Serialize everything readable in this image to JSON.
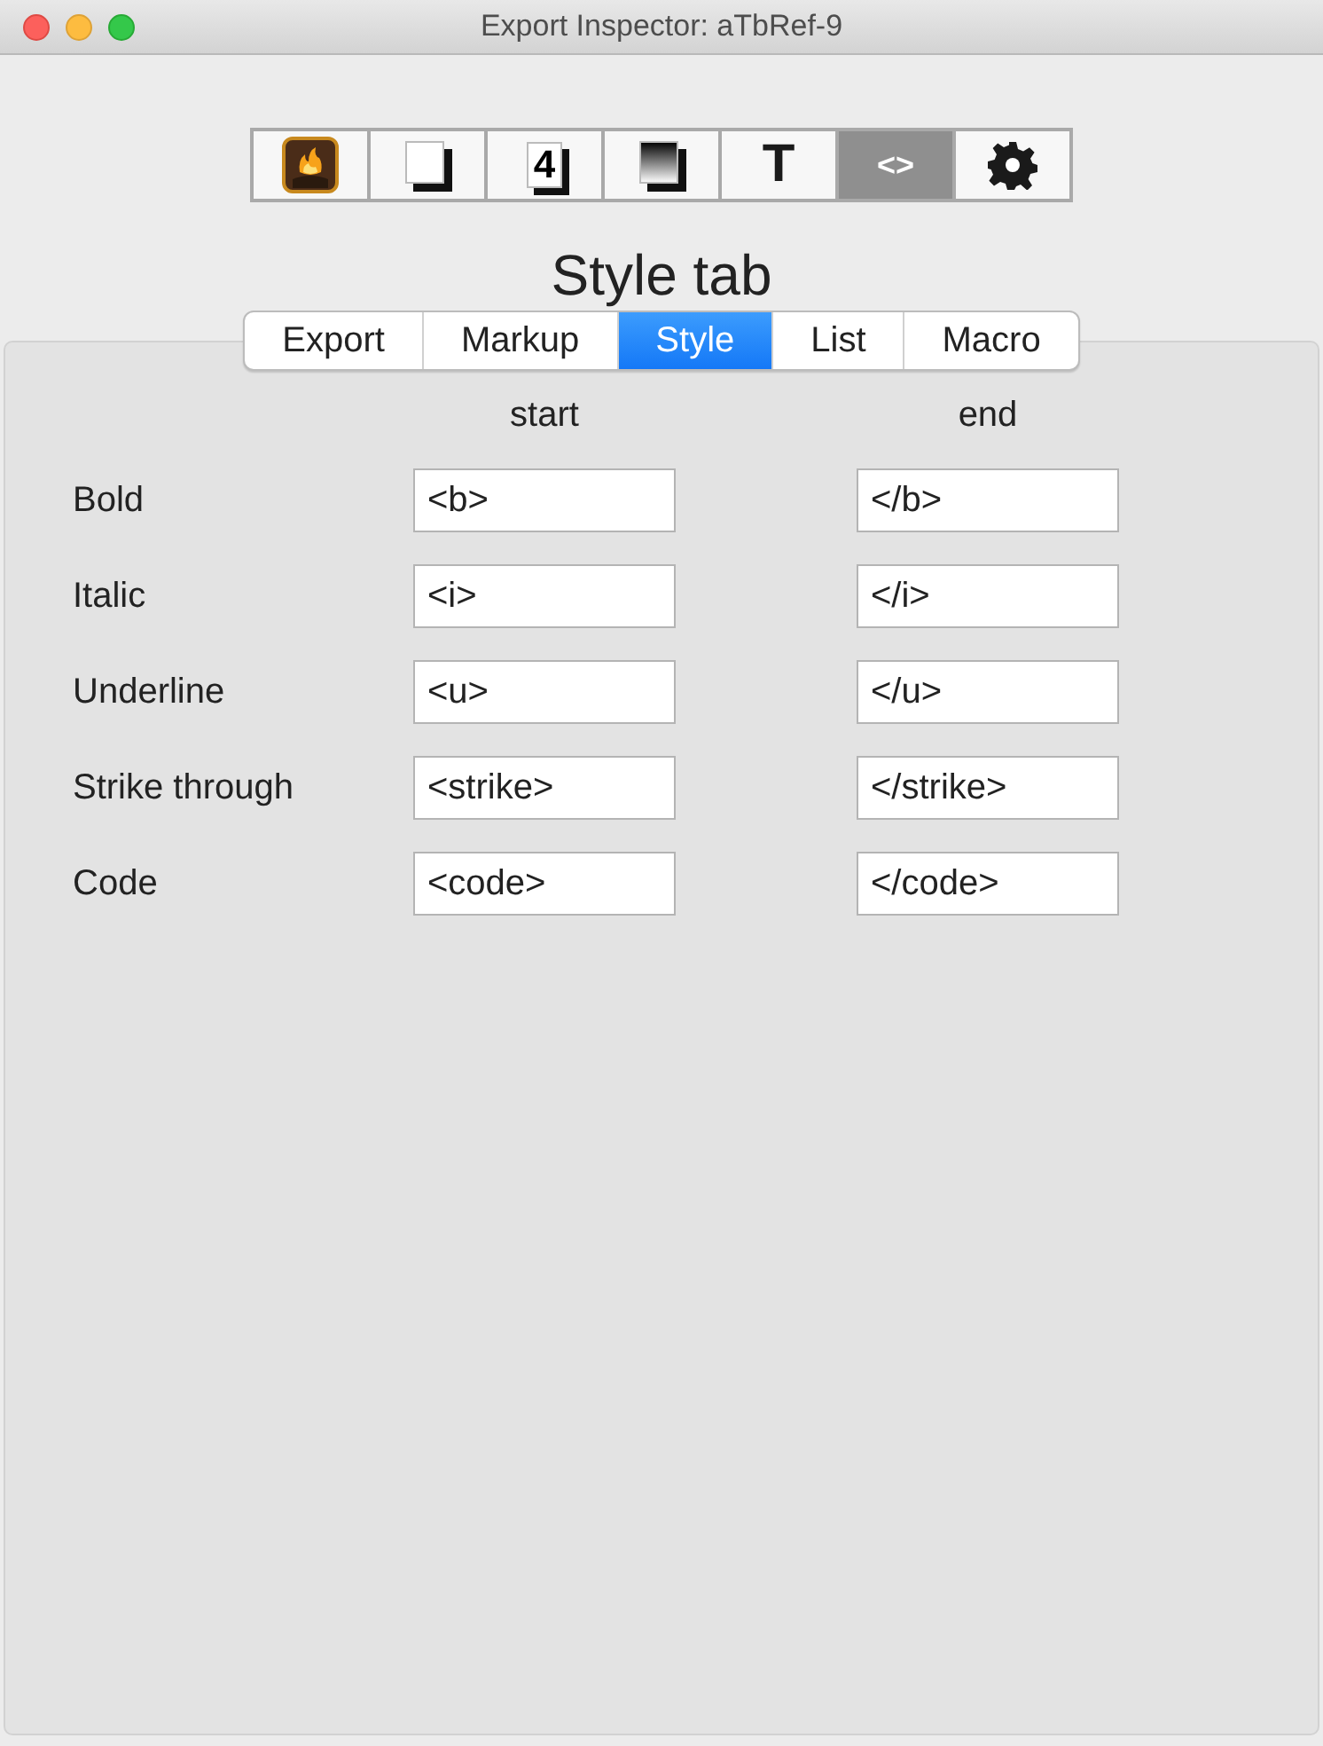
{
  "window": {
    "title": "Export Inspector: aTbRef-9"
  },
  "toolbar": [
    {
      "kind": "flame",
      "selected": false
    },
    {
      "kind": "page",
      "selected": false
    },
    {
      "kind": "number",
      "label": "4",
      "selected": false
    },
    {
      "kind": "gradient",
      "selected": false
    },
    {
      "kind": "text",
      "label": "T",
      "selected": false
    },
    {
      "kind": "code",
      "label": "<>",
      "selected": true
    },
    {
      "kind": "gear",
      "selected": false
    }
  ],
  "heading": "Style tab",
  "tabs": [
    {
      "label": "Export",
      "selected": false
    },
    {
      "label": "Markup",
      "selected": false
    },
    {
      "label": "Style",
      "selected": true
    },
    {
      "label": "List",
      "selected": false
    },
    {
      "label": "Macro",
      "selected": false
    }
  ],
  "columns": [
    "start",
    "end"
  ],
  "rows": [
    {
      "label": "Bold",
      "start": "<b>",
      "end": "</b>"
    },
    {
      "label": "Italic",
      "start": "<i>",
      "end": "</i>"
    },
    {
      "label": "Underline",
      "start": "<u>",
      "end": "</u>"
    },
    {
      "label": "Strike through",
      "start": "<strike>",
      "end": "</strike>"
    },
    {
      "label": "Code",
      "start": "<code>",
      "end": "</code>"
    }
  ]
}
